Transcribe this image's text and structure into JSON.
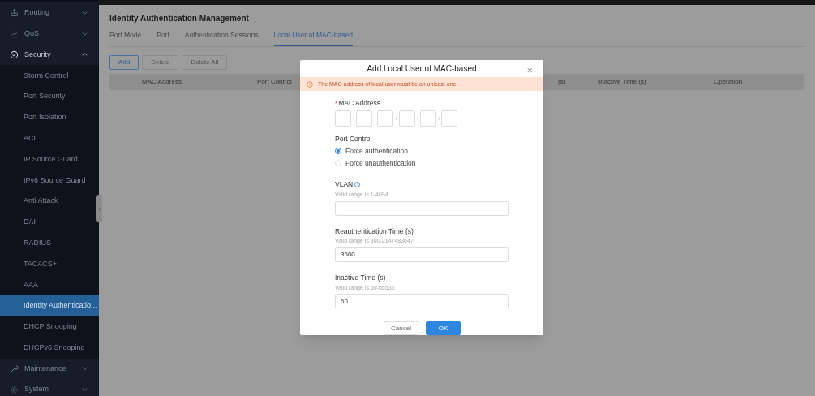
{
  "sidebar": {
    "items": [
      {
        "kind": "group",
        "label": "Routing",
        "expanded": false,
        "selected": false
      },
      {
        "kind": "group",
        "label": "QoS",
        "expanded": false,
        "selected": false
      },
      {
        "kind": "group",
        "label": "Security",
        "expanded": true,
        "selected": false
      },
      {
        "kind": "item",
        "label": "Storm Control",
        "selected": false
      },
      {
        "kind": "item",
        "label": "Port Security",
        "selected": false
      },
      {
        "kind": "item",
        "label": "Port Isolation",
        "selected": false
      },
      {
        "kind": "item",
        "label": "ACL",
        "selected": false
      },
      {
        "kind": "item",
        "label": "IP Source Guard",
        "selected": false
      },
      {
        "kind": "item",
        "label": "IPv6 Source Guard",
        "selected": false
      },
      {
        "kind": "item",
        "label": "Anti Attack",
        "selected": false
      },
      {
        "kind": "item",
        "label": "DAI",
        "selected": false
      },
      {
        "kind": "item",
        "label": "RADIUS",
        "selected": false
      },
      {
        "kind": "item",
        "label": "TACACS+",
        "selected": false
      },
      {
        "kind": "item",
        "label": "AAA",
        "selected": false
      },
      {
        "kind": "item",
        "label": "Identity Authenticatio...",
        "selected": true
      },
      {
        "kind": "item",
        "label": "DHCP Snooping",
        "selected": false
      },
      {
        "kind": "item",
        "label": "DHCPv6 Snooping",
        "selected": false
      },
      {
        "kind": "group",
        "label": "Maintenance",
        "expanded": false,
        "selected": false
      },
      {
        "kind": "group",
        "label": "System",
        "expanded": false,
        "selected": false
      }
    ]
  },
  "page": {
    "title": "Identity Authentication Management",
    "tabs": [
      {
        "label": "Port Mode",
        "selected": false
      },
      {
        "label": "Port",
        "selected": false
      },
      {
        "label": "Authentication Sessions",
        "selected": false
      },
      {
        "label": "Local User of MAC-based",
        "selected": true
      }
    ],
    "toolbar": [
      {
        "label": "Add",
        "disabled": false
      },
      {
        "label": "Delete",
        "disabled": true
      },
      {
        "label": "Delete All",
        "disabled": true
      }
    ],
    "table": {
      "columns": [
        "MAC Address",
        "Port Control",
        "(s)",
        "Inactive Time (s)",
        "Operation"
      ]
    }
  },
  "dialog": {
    "title": "Add Local User of MAC-based",
    "close": "×",
    "warning": "The MAC address of local user must be an unicast one.",
    "mac": {
      "label": "MAC Address",
      "required_mark": "*",
      "separators": [
        ":",
        ":",
        ":",
        ":",
        ":"
      ]
    },
    "port_control": {
      "label": "Port Control",
      "options": [
        {
          "label": "Force authentication",
          "selected": true
        },
        {
          "label": "Force unauthentication",
          "selected": false
        }
      ]
    },
    "fields": [
      {
        "label": "VLAN",
        "info": true,
        "hint": "Valid range is 1-4094"
      },
      {
        "label": "Reauthentication Time (s)",
        "hint": "Valid range is 300-2147483647",
        "value": "3600"
      },
      {
        "label": "Inactive Time (s)",
        "hint": "Valid range is 60-65535",
        "value": "60"
      }
    ],
    "buttons": [
      {
        "label": "Cancel",
        "kind": "secondary"
      },
      {
        "label": "OK",
        "kind": "primary"
      }
    ]
  }
}
